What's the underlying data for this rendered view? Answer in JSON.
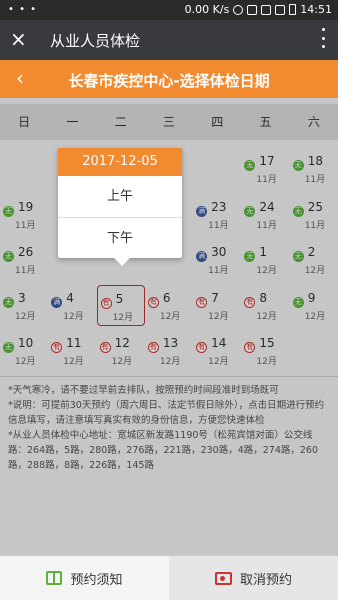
{
  "statusbar": {
    "dots": "• • •",
    "speed": "0.00 K/s",
    "time": "14:51"
  },
  "appbar": {
    "title": "从业人员体检",
    "close_icon": "×"
  },
  "header": {
    "title": "长春市疾控中心-选择体检日期",
    "back_icon": "‹"
  },
  "weekdays": [
    "日",
    "一",
    "二",
    "三",
    "四",
    "五",
    "六"
  ],
  "calendar": [
    {
      "row": 0,
      "col": 5,
      "day": "17",
      "month": "11月",
      "badge": "g",
      "badge_text": "无"
    },
    {
      "row": 0,
      "col": 6,
      "day": "18",
      "month": "11月",
      "badge": "g",
      "badge_text": "无"
    },
    {
      "row": 1,
      "col": 0,
      "day": "19",
      "month": "11月",
      "badge": "g",
      "badge_text": "无"
    },
    {
      "row": 1,
      "col": 4,
      "day": "23",
      "month": "11月",
      "badge": "b",
      "badge_text": "满"
    },
    {
      "row": 1,
      "col": 5,
      "day": "24",
      "month": "11月",
      "badge": "g",
      "badge_text": "无"
    },
    {
      "row": 1,
      "col": 6,
      "day": "25",
      "month": "11月",
      "badge": "g",
      "badge_text": "无"
    },
    {
      "row": 2,
      "col": 0,
      "day": "26",
      "month": "11月",
      "badge": "g",
      "badge_text": "无"
    },
    {
      "row": 2,
      "col": 4,
      "day": "30",
      "month": "11月",
      "badge": "b",
      "badge_text": "满"
    },
    {
      "row": 2,
      "col": 5,
      "day": "1",
      "month": "12月",
      "badge": "g",
      "badge_text": "无"
    },
    {
      "row": 2,
      "col": 6,
      "day": "2",
      "month": "12月",
      "badge": "g",
      "badge_text": "无"
    },
    {
      "row": 3,
      "col": 0,
      "day": "3",
      "month": "12月",
      "badge": "g",
      "badge_text": "无"
    },
    {
      "row": 3,
      "col": 1,
      "day": "4",
      "month": "12月",
      "badge": "b",
      "badge_text": "满"
    },
    {
      "row": 3,
      "col": 2,
      "day": "5",
      "month": "12月",
      "badge": "r",
      "badge_text": "有",
      "selected": true
    },
    {
      "row": 3,
      "col": 3,
      "day": "6",
      "month": "12月",
      "badge": "r",
      "badge_text": "有"
    },
    {
      "row": 3,
      "col": 4,
      "day": "7",
      "month": "12月",
      "badge": "r",
      "badge_text": "有"
    },
    {
      "row": 3,
      "col": 5,
      "day": "8",
      "month": "12月",
      "badge": "r",
      "badge_text": "有"
    },
    {
      "row": 3,
      "col": 6,
      "day": "9",
      "month": "12月",
      "badge": "g",
      "badge_text": "无"
    },
    {
      "row": 4,
      "col": 0,
      "day": "10",
      "month": "12月",
      "badge": "g",
      "badge_text": "无"
    },
    {
      "row": 4,
      "col": 1,
      "day": "11",
      "month": "12月",
      "badge": "r",
      "badge_text": "有"
    },
    {
      "row": 4,
      "col": 2,
      "day": "12",
      "month": "12月",
      "badge": "r",
      "badge_text": "有"
    },
    {
      "row": 4,
      "col": 3,
      "day": "13",
      "month": "12月",
      "badge": "r",
      "badge_text": "有"
    },
    {
      "row": 4,
      "col": 4,
      "day": "14",
      "month": "12月",
      "badge": "r",
      "badge_text": "有"
    },
    {
      "row": 4,
      "col": 5,
      "day": "15",
      "month": "12月",
      "badge": "r",
      "badge_text": "有"
    }
  ],
  "popup": {
    "date": "2017-12-05",
    "morning": "上午",
    "afternoon": "下午"
  },
  "notes": [
    "*天气寒冷，请不要过早前去排队，按照预约时间段准时到场既可",
    "*说明：可提前30天预约（周六周日、法定节假日除外），点击日期进行预约信息填写，请注意填写真实有效的身份信息，方便您快速体检",
    "*从业人员体检中心地址：宽城区新发路1190号（松苑宾馆对面）公交线路：264路，5路，280路，276路，221路，230路，4路，274路，260路，288路，8路，226路，145路"
  ],
  "bottombar": {
    "guide_label": "预约须知",
    "cancel_label": "取消预约"
  }
}
